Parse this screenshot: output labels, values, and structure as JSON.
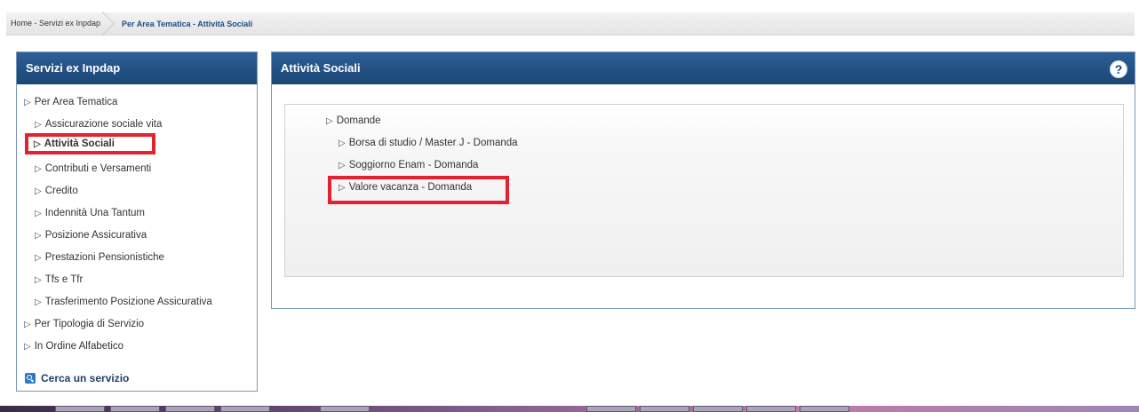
{
  "breadcrumb": {
    "home": "Home - Servizi ex Inpdap",
    "current": "Per Area Tematica - Attività Sociali"
  },
  "sidebar": {
    "title": "Servizi ex Inpdap",
    "items": [
      {
        "label": "Per Area Tematica",
        "level": 0
      },
      {
        "label": "Assicurazione sociale vita",
        "level": 1
      },
      {
        "label": "Attività Sociali",
        "level": 1,
        "active": true
      },
      {
        "label": "Contributi e Versamenti",
        "level": 1
      },
      {
        "label": "Credito",
        "level": 1
      },
      {
        "label": "Indennità Una Tantum",
        "level": 1
      },
      {
        "label": "Posizione Assicurativa",
        "level": 1
      },
      {
        "label": "Prestazioni Pensionistiche",
        "level": 1
      },
      {
        "label": "Tfs e Tfr",
        "level": 1
      },
      {
        "label": "Trasferimento Posizione Assicurativa",
        "level": 1
      },
      {
        "label": "Per Tipologia di Servizio",
        "level": 0
      },
      {
        "label": "In Ordine Alfabetico",
        "level": 0
      }
    ],
    "search_label": "Cerca un servizio"
  },
  "main": {
    "title": "Attività Sociali",
    "help_glyph": "?",
    "tree": [
      {
        "label": "Domande",
        "level": 0
      },
      {
        "label": "Borsa di studio / Master J - Domanda",
        "level": 1
      },
      {
        "label": "Soggiorno Enam - Domanda",
        "level": 1
      },
      {
        "label": "Valore vacanza - Domanda",
        "level": 1,
        "highlighted": true
      }
    ]
  },
  "icons": {
    "bullet": "triangle-right-icon",
    "help": "help-icon",
    "search": "search-icon"
  },
  "colors": {
    "header_blue": "#1c4677",
    "highlight_red": "#e3222f"
  }
}
